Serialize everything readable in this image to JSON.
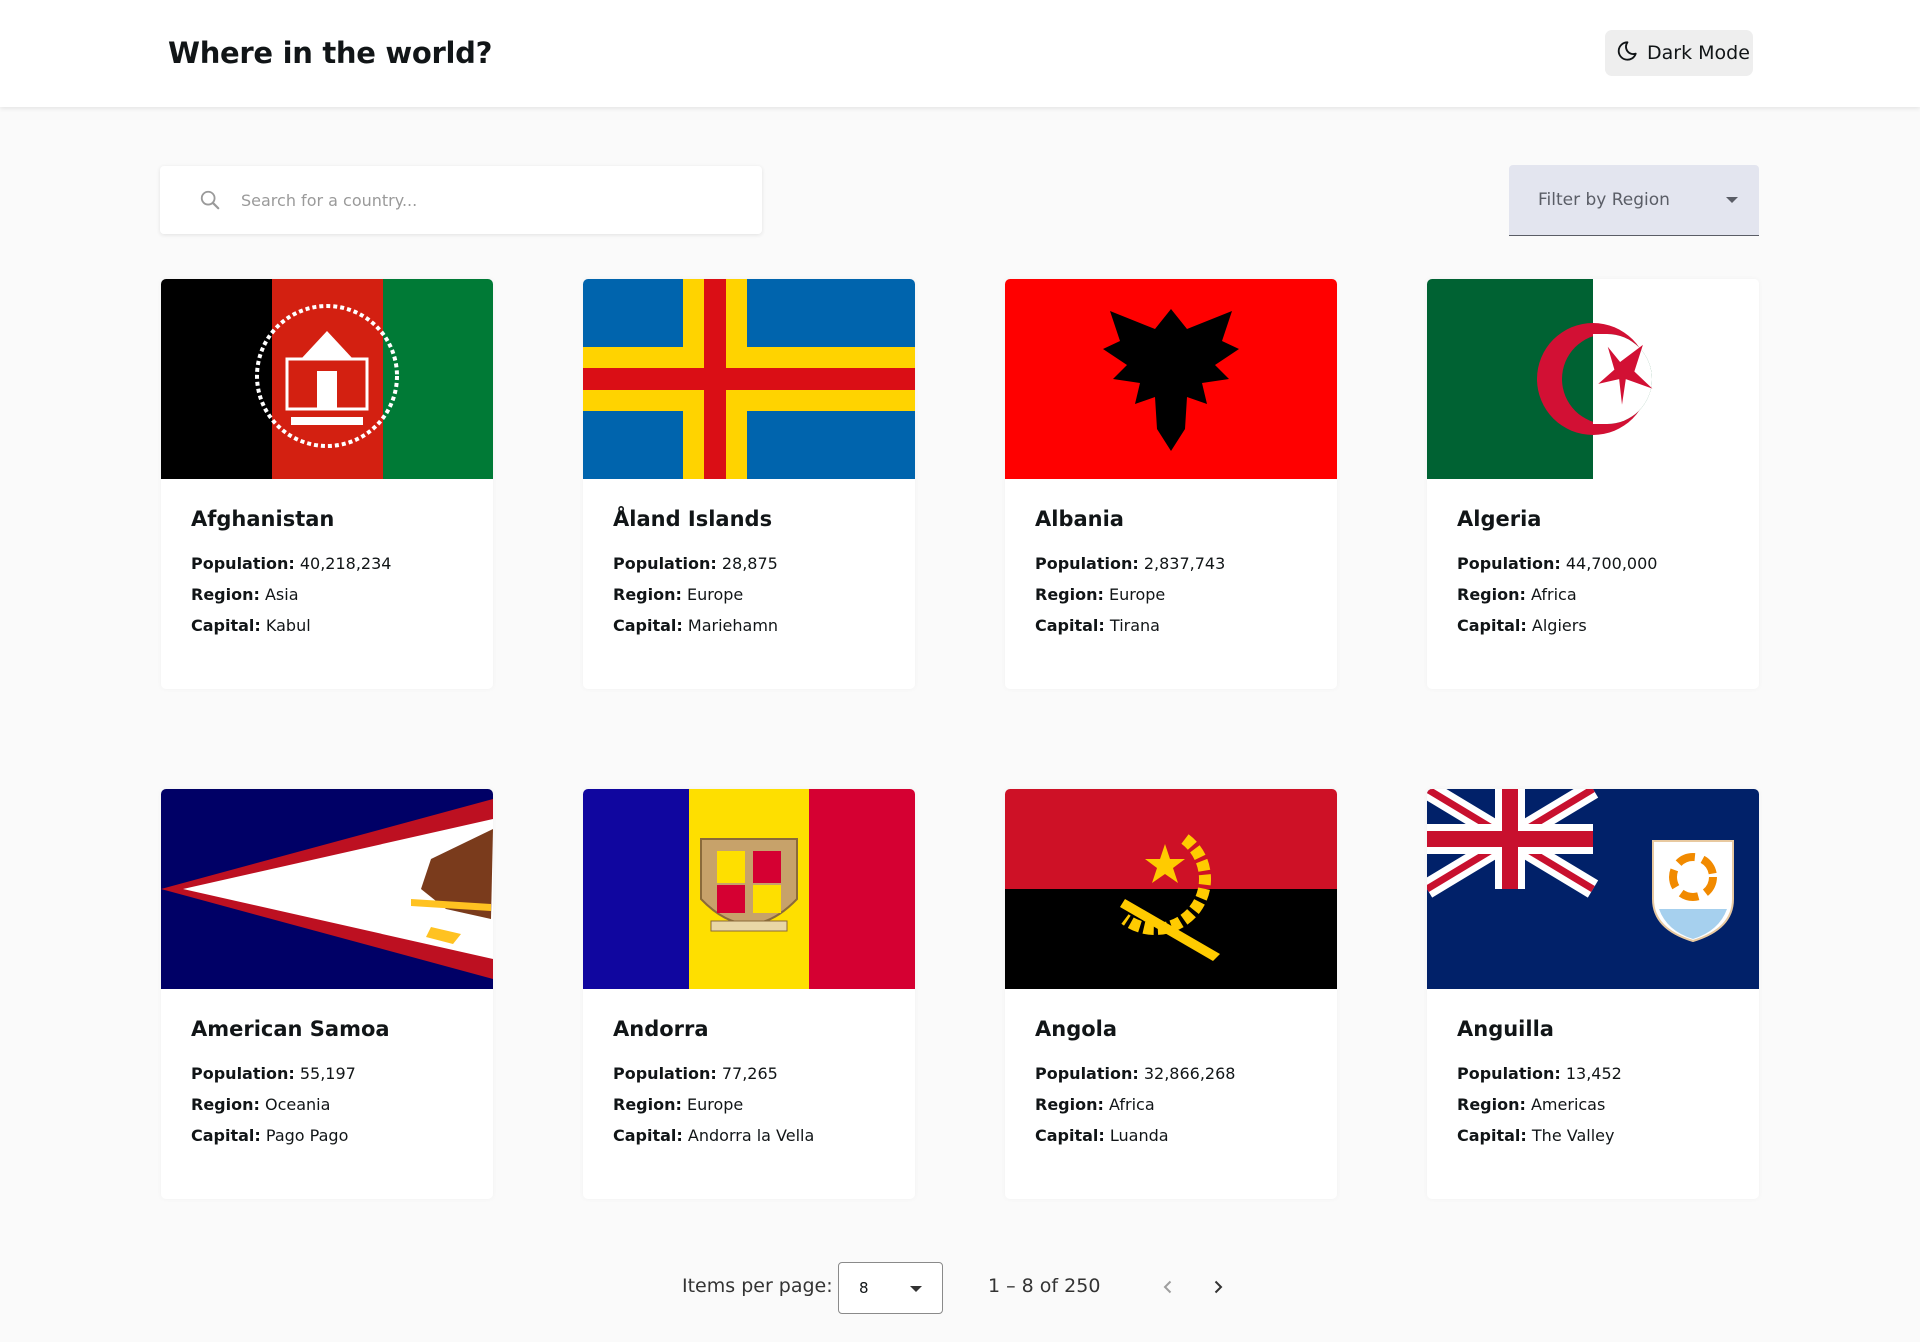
{
  "header": {
    "title": "Where in the world?",
    "dark_mode_label": "Dark Mode",
    "dark_mode_icon": "moon-icon"
  },
  "search": {
    "placeholder": "Search for a country...",
    "value": "",
    "icon": "search-icon"
  },
  "filter": {
    "label": "Filter by Region",
    "icon": "caret-down-icon"
  },
  "labels": {
    "population": "Population:",
    "region": "Region:",
    "capital": "Capital:"
  },
  "countries": [
    {
      "name": "Afghanistan",
      "population": "40,218,234",
      "region": "Asia",
      "capital": "Kabul",
      "flag": "afghanistan-flag"
    },
    {
      "name": "Åland Islands",
      "population": "28,875",
      "region": "Europe",
      "capital": "Mariehamn",
      "flag": "aland-islands-flag"
    },
    {
      "name": "Albania",
      "population": "2,837,743",
      "region": "Europe",
      "capital": "Tirana",
      "flag": "albania-flag"
    },
    {
      "name": "Algeria",
      "population": "44,700,000",
      "region": "Africa",
      "capital": "Algiers",
      "flag": "algeria-flag"
    },
    {
      "name": "American Samoa",
      "population": "55,197",
      "region": "Oceania",
      "capital": "Pago Pago",
      "flag": "american-samoa-flag"
    },
    {
      "name": "Andorra",
      "population": "77,265",
      "region": "Europe",
      "capital": "Andorra la Vella",
      "flag": "andorra-flag"
    },
    {
      "name": "Angola",
      "population": "32,866,268",
      "region": "Africa",
      "capital": "Luanda",
      "flag": "angola-flag"
    },
    {
      "name": "Anguilla",
      "population": "13,452",
      "region": "Americas",
      "capital": "The Valley",
      "flag": "anguilla-flag"
    }
  ],
  "pagination": {
    "items_per_page_label": "Items per page:",
    "items_per_page_value": "8",
    "range_label": "1 – 8 of 250"
  },
  "colors": {
    "background": "#fafafa",
    "surface": "#ffffff",
    "text": "#111517",
    "filter_bg": "#e3e5ef"
  }
}
